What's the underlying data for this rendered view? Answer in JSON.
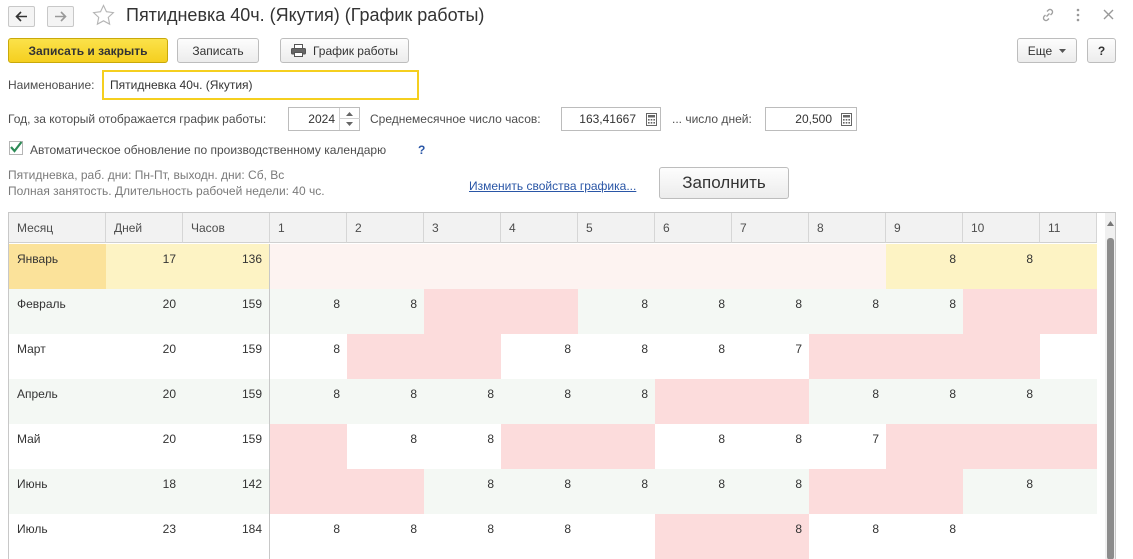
{
  "window": {
    "title": "Пятидневка 40ч. (Якутия) (График работы)",
    "back_icon": "arrow-left-icon",
    "forward_icon": "arrow-right-icon",
    "star_icon": "star-icon",
    "link_icon": "link-icon",
    "menu_icon": "more-vertical-icon",
    "close_icon": "close-icon"
  },
  "toolbar": {
    "save_close": "Записать и закрыть",
    "save": "Записать",
    "schedule": "График работы",
    "more": "Еще",
    "help": "?"
  },
  "form": {
    "name_label": "Наименование:",
    "name_value": "Пятидневка 40ч. (Якутия)",
    "year_label": "Год, за который отображается график работы:",
    "year_value": "2024",
    "avg_hours_label": "Среднемесячное число часов:",
    "avg_hours_value": "163,41667",
    "days_label": "... число дней:",
    "days_value": "20,500",
    "auto_update_label": "Автоматическое обновление по производственному календарю",
    "auto_update_help": "?",
    "hint_line1": "Пятидневка, раб. дни: Пн-Пт, выходн. дни: Сб, Вс",
    "hint_line2": "Полная занятость. Длительность рабочей недели: 40 чс.",
    "change_link": "Изменить свойства графика...",
    "fill_button": "Заполнить"
  },
  "colors": {
    "accent_yellow": "#f5cf1f",
    "weekend_pink": "#fcdcdc",
    "selected_row": "#fdf3c4",
    "selected_month": "#fbe29a",
    "alt_row": "#f4f8f4"
  },
  "table": {
    "headers": [
      "Месяц",
      "Дней",
      "Часов",
      "1",
      "2",
      "3",
      "4",
      "5",
      "6",
      "7",
      "8",
      "9",
      "10",
      "11"
    ],
    "rows": [
      {
        "month": "Январь",
        "days": "17",
        "hours": "136",
        "cells": [
          "",
          "",
          "",
          "",
          "",
          "",
          "",
          "",
          "8",
          "8",
          ""
        ],
        "off": [
          1,
          1,
          1,
          1,
          1,
          1,
          1,
          1,
          0,
          0,
          0
        ]
      },
      {
        "month": "Февраль",
        "days": "20",
        "hours": "159",
        "cells": [
          "8",
          "8",
          "",
          "",
          "8",
          "8",
          "8",
          "8",
          "8",
          "",
          ""
        ],
        "off": [
          0,
          0,
          1,
          1,
          0,
          0,
          0,
          0,
          0,
          1,
          1
        ]
      },
      {
        "month": "Март",
        "days": "20",
        "hours": "159",
        "cells": [
          "8",
          "",
          "",
          "8",
          "8",
          "8",
          "7",
          "",
          "",
          "",
          ""
        ],
        "off": [
          0,
          1,
          1,
          0,
          0,
          0,
          0,
          1,
          1,
          1,
          0
        ]
      },
      {
        "month": "Апрель",
        "days": "20",
        "hours": "159",
        "cells": [
          "8",
          "8",
          "8",
          "8",
          "8",
          "",
          "",
          "8",
          "8",
          "8",
          ""
        ],
        "off": [
          0,
          0,
          0,
          0,
          0,
          1,
          1,
          0,
          0,
          0,
          0
        ]
      },
      {
        "month": "Май",
        "days": "20",
        "hours": "159",
        "cells": [
          "",
          "8",
          "8",
          "",
          "",
          "8",
          "8",
          "7",
          "",
          "",
          ""
        ],
        "off": [
          1,
          0,
          0,
          1,
          1,
          0,
          0,
          0,
          1,
          1,
          1
        ]
      },
      {
        "month": "Июнь",
        "days": "18",
        "hours": "142",
        "cells": [
          "",
          "",
          "8",
          "8",
          "8",
          "8",
          "8",
          "",
          "",
          "8",
          ""
        ],
        "off": [
          1,
          1,
          0,
          0,
          0,
          0,
          0,
          1,
          1,
          0,
          0
        ]
      },
      {
        "month": "Июль",
        "days": "23",
        "hours": "184",
        "cells": [
          "8",
          "8",
          "8",
          "8",
          "",
          "",
          "8",
          "8",
          "8",
          "",
          ""
        ],
        "off": [
          0,
          0,
          0,
          0,
          0,
          1,
          1,
          0,
          0,
          0,
          0
        ]
      }
    ]
  }
}
